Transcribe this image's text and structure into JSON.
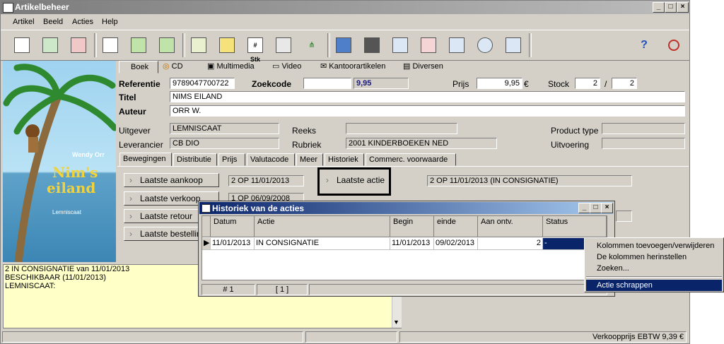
{
  "window": {
    "title": "Artikelbeheer"
  },
  "menu": [
    "Artikel",
    "Beeld",
    "Acties",
    "Help"
  ],
  "toolbar": {
    "stk_label": "# Stk"
  },
  "type_tabs": [
    "Boek",
    "CD",
    "Multimedia",
    "Video",
    "Kantoorartikelen",
    "Diversen"
  ],
  "cover": {
    "author": "Wendy Orr",
    "title_line1": "Nim's",
    "title_line2": "eiland",
    "publisher": "Lemniscaat"
  },
  "form": {
    "referentie_label": "Referentie",
    "referentie": "9789047700722",
    "zoekcode_label": "Zoekcode",
    "zoekcode": "",
    "extra_price": "9,95",
    "prijs_label": "Prijs",
    "prijs": "9,95",
    "currency": "€",
    "stock_label": "Stock",
    "stock_a": "2",
    "stock_sep": "/",
    "stock_b": "2",
    "titel_label": "Titel",
    "titel": "NIMS EILAND",
    "auteur_label": "Auteur",
    "auteur": "ORR W.",
    "uitgever_label": "Uitgever",
    "uitgever": "LEMNISCAAT",
    "reeks_label": "Reeks",
    "reeks": "",
    "producttype_label": "Product type",
    "producttype": "",
    "leverancier_label": "Leverancier",
    "leverancier": "CB DIO",
    "rubriek_label": "Rubriek",
    "rubriek": "2001 KINDERBOEKEN NED",
    "uitvoering_label": "Uitvoering",
    "uitvoering": ""
  },
  "detail_tabs": [
    "Bewegingen",
    "Distributie",
    "Prijs",
    "Valutacode",
    "Meer",
    "Historiek",
    "Commerc. voorwaarde"
  ],
  "movements": {
    "laatste_aankoop_label": "Laatste aankoop",
    "laatste_aankoop": "2 OP 11/01/2013",
    "laatste_actie_label": "Laatste actie",
    "laatste_actie": "2 OP 11/01/2013 (IN CONSIGNATIE)",
    "laatste_verkoop_label": "Laatste verkoop",
    "laatste_verkoop": "1 OP 06/09/2008",
    "laatste_retour_label": "Laatste retour",
    "laatste_bestelling_label": "Laatste bestellin"
  },
  "memo": [
    "2 IN CONSIGNATIE van 11/01/2013",
    "BESCHIKBAAR (11/01/2013)",
    "LEMNISCAAT:"
  ],
  "dialog": {
    "title": "Historiek van de acties",
    "columns": [
      "Datum",
      "Actie",
      "Begin",
      "einde",
      "Aan ontv.",
      "Status"
    ],
    "rows": [
      {
        "datum": "11/01/2013",
        "actie": "IN CONSIGNATIE",
        "begin": "11/01/2013",
        "einde": "09/02/2013",
        "aan_ontv": "2",
        "status": "-"
      }
    ],
    "nav_count": "# 1",
    "nav_page": "[ 1 ]"
  },
  "context_menu": [
    "Kolommen toevoegen/verwijderen",
    "De kolommen herinstellen",
    "Zoeken...",
    "Actie schrappen"
  ],
  "statusbar": {
    "text": "Verkoopprijs EBTW 9,39 €"
  },
  "colors": {
    "title_active": "#0a246a",
    "title_inactive": "#7b7b7b",
    "memo_bg": "#ffffc8",
    "highlight": "#0a246a"
  }
}
